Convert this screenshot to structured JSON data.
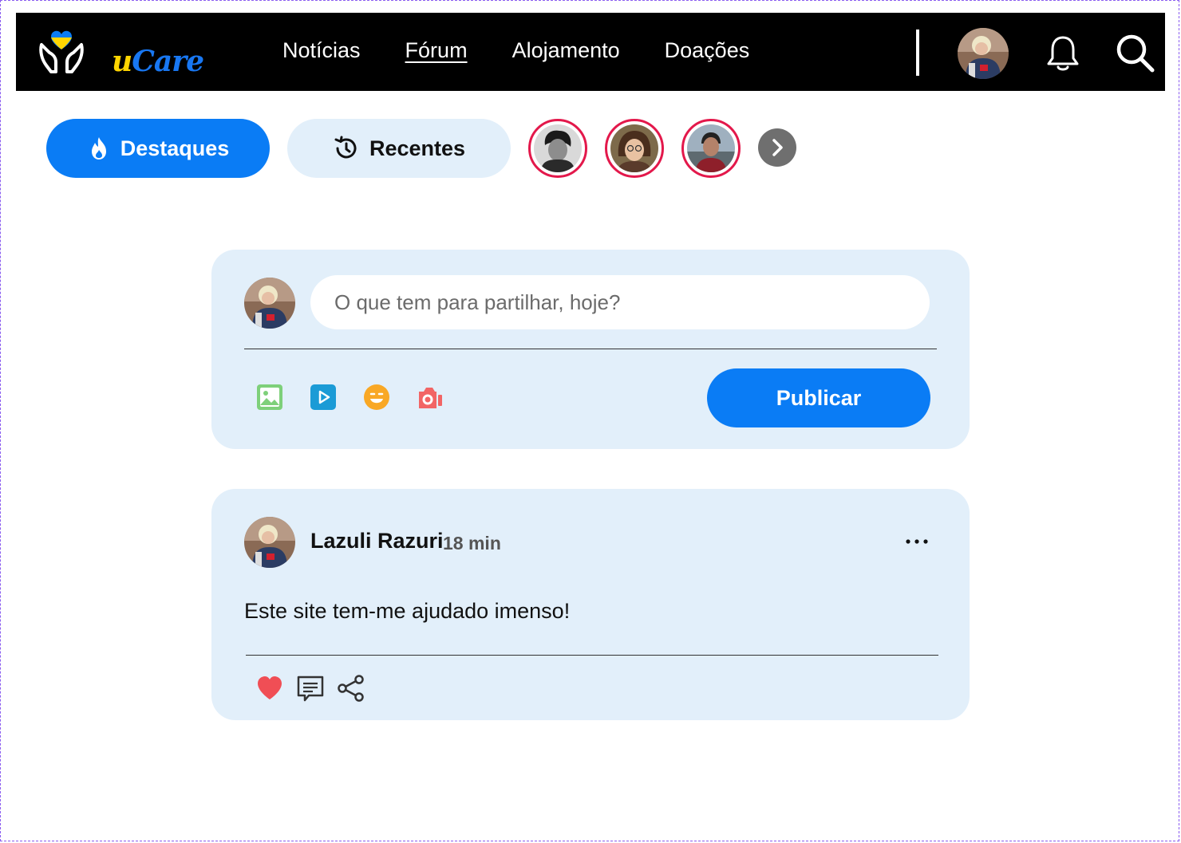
{
  "brand": {
    "name_prefix": "u",
    "name_suffix": "Care",
    "colors": {
      "blue": "#0a7cf5",
      "yellow": "#ffd500"
    }
  },
  "nav": {
    "links": [
      {
        "label": "Notícias",
        "active": false
      },
      {
        "label": "Fórum",
        "active": true
      },
      {
        "label": "Alojamento",
        "active": false
      },
      {
        "label": "Doações",
        "active": false
      }
    ],
    "icons": [
      "user-avatar",
      "bell-icon",
      "search-icon"
    ]
  },
  "tabs": {
    "destaques": {
      "label": "Destaques",
      "icon": "flame-icon",
      "active": true
    },
    "recentes": {
      "label": "Recentes",
      "icon": "clock-refresh-icon",
      "active": false
    }
  },
  "stories": {
    "count_visible": 3,
    "next_icon": "chevron-right-icon",
    "ring_color": "#e3184b"
  },
  "composer": {
    "placeholder": "O que tem para partilhar, hoje?",
    "media_icons": [
      "image-icon",
      "video-icon",
      "emoji-icon",
      "camera-icon"
    ],
    "publish_label": "Publicar"
  },
  "post": {
    "author": "Lazuli Razuri",
    "time": "18 min",
    "text": "Este site tem-me ajudado imenso!",
    "actions": [
      "heart-icon",
      "comment-icon",
      "share-icon"
    ],
    "menu_icon": "more-options-icon"
  }
}
